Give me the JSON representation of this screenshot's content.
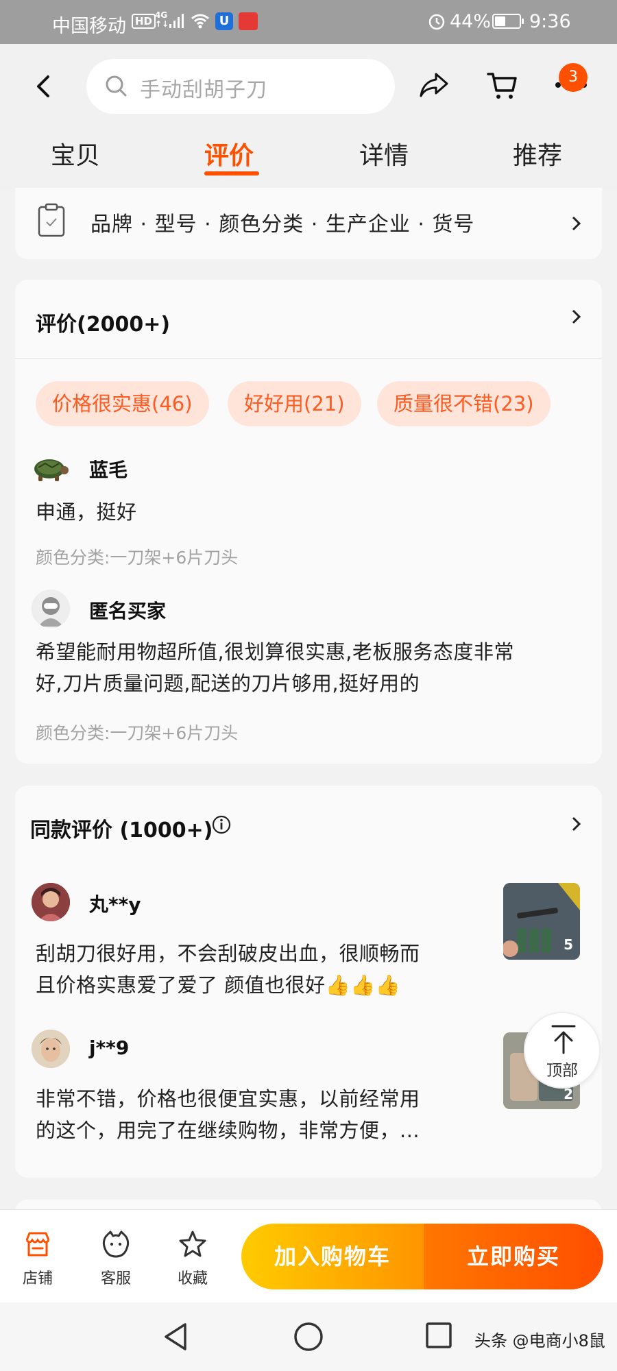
{
  "status_bar": {
    "carrier": "中国移动",
    "hd": "HD",
    "network_top": "4G",
    "network_bottom": "↑↓",
    "battery_percent": "44%",
    "battery_level": 0.44,
    "time": "9:36"
  },
  "header": {
    "search_placeholder": "手动刮胡子刀",
    "cart_badge": "3",
    "tabs": [
      {
        "label": "宝贝",
        "active": false
      },
      {
        "label": "评价",
        "active": true
      },
      {
        "label": "详情",
        "active": false
      },
      {
        "label": "推荐",
        "active": false
      }
    ]
  },
  "params": {
    "text": "品牌 · 型号 · 颜色分类 · 生产企业 · 货号"
  },
  "reviews": {
    "title": "评价(2000+)",
    "tags": [
      "价格很实惠(46)",
      "好好用(21)",
      "质量很不错(23)"
    ],
    "items": [
      {
        "user": "蓝毛",
        "text_lines": [
          "申通，挺好"
        ],
        "sku": "颜色分类:一刀架+6片刀头"
      },
      {
        "user": "匿名买家",
        "text_lines": [
          "希望能耐用物超所值,很划算很实惠,老板服务态度非常",
          "好,刀片质量问题,配送的刀片够用,挺好用的"
        ],
        "sku": "颜色分类:一刀架+6片刀头"
      }
    ]
  },
  "same_reviews": {
    "title": "同款评价 (1000+)",
    "items": [
      {
        "user": "丸**y",
        "text_lines": [
          "刮胡刀很好用，不会刮破皮出血，很顺畅而",
          "且价格实惠爱了爱了 颜值也很好👍👍👍"
        ],
        "photo_count": "5"
      },
      {
        "user": "j**9",
        "text_lines": [
          "非常不错，价格也很便宜实惠，以前经常用",
          "的这个，用完了在继续购物，非常方便，..."
        ],
        "photo_count": "2"
      }
    ]
  },
  "to_top": {
    "label": "顶部"
  },
  "bottom_bar": {
    "shop": "店铺",
    "service": "客服",
    "favorite": "收藏",
    "add_to_cart": "加入购物车",
    "buy_now": "立即购买"
  },
  "watermark": "头条 @电商小8鼠",
  "colors": {
    "accent": "#ff5000",
    "tag_bg": "#ffe4da",
    "cart_button": "#ffb300",
    "buy_button": "#ff5a00"
  }
}
